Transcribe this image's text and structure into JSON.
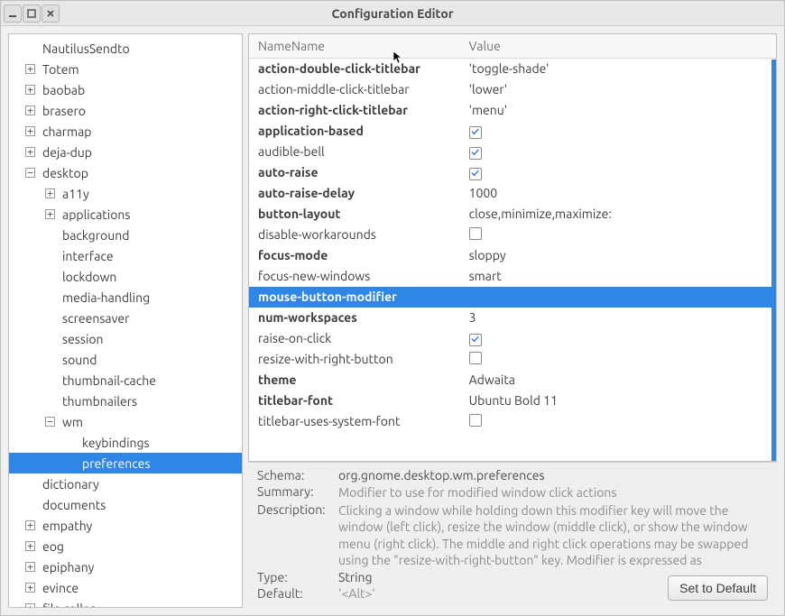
{
  "window_title": "Configuration Editor",
  "tree": [
    {
      "level": 1,
      "expand": "",
      "label": "NautilusSendto"
    },
    {
      "level": 1,
      "expand": "+",
      "label": "Totem"
    },
    {
      "level": 1,
      "expand": "+",
      "label": "baobab"
    },
    {
      "level": 1,
      "expand": "+",
      "label": "brasero"
    },
    {
      "level": 1,
      "expand": "+",
      "label": "charmap"
    },
    {
      "level": 1,
      "expand": "+",
      "label": "deja-dup"
    },
    {
      "level": 1,
      "expand": "-",
      "label": "desktop"
    },
    {
      "level": 2,
      "expand": "+",
      "label": "a11y"
    },
    {
      "level": 2,
      "expand": "+",
      "label": "applications"
    },
    {
      "level": 2,
      "expand": "",
      "label": "background"
    },
    {
      "level": 2,
      "expand": "",
      "label": "interface"
    },
    {
      "level": 2,
      "expand": "",
      "label": "lockdown"
    },
    {
      "level": 2,
      "expand": "",
      "label": "media-handling"
    },
    {
      "level": 2,
      "expand": "",
      "label": "screensaver"
    },
    {
      "level": 2,
      "expand": "",
      "label": "session"
    },
    {
      "level": 2,
      "expand": "",
      "label": "sound"
    },
    {
      "level": 2,
      "expand": "",
      "label": "thumbnail-cache"
    },
    {
      "level": 2,
      "expand": "",
      "label": "thumbnailers"
    },
    {
      "level": 2,
      "expand": "-",
      "label": "wm"
    },
    {
      "level": 3,
      "expand": "",
      "label": "keybindings"
    },
    {
      "level": 3,
      "expand": "",
      "label": "preferences",
      "selected": true
    },
    {
      "level": 1,
      "expand": "",
      "label": "dictionary"
    },
    {
      "level": 1,
      "expand": "",
      "label": "documents"
    },
    {
      "level": 1,
      "expand": "+",
      "label": "empathy"
    },
    {
      "level": 1,
      "expand": "+",
      "label": "eog"
    },
    {
      "level": 1,
      "expand": "+",
      "label": "epiphany"
    },
    {
      "level": 1,
      "expand": "+",
      "label": "evince"
    },
    {
      "level": 1,
      "expand": "+",
      "label": "file-roller"
    }
  ],
  "columns": {
    "name": "Name",
    "value": "Value"
  },
  "rows": [
    {
      "name": "action-double-click-titlebar",
      "bold": true,
      "valtype": "text",
      "value": "'toggle-shade'"
    },
    {
      "name": "action-middle-click-titlebar",
      "bold": false,
      "valtype": "text",
      "value": "'lower'"
    },
    {
      "name": "action-right-click-titlebar",
      "bold": true,
      "valtype": "text",
      "value": "'menu'"
    },
    {
      "name": "application-based",
      "bold": true,
      "valtype": "check",
      "value": true
    },
    {
      "name": "audible-bell",
      "bold": false,
      "valtype": "check",
      "value": true
    },
    {
      "name": "auto-raise",
      "bold": true,
      "valtype": "check",
      "value": true
    },
    {
      "name": "auto-raise-delay",
      "bold": true,
      "valtype": "text",
      "value": "1000"
    },
    {
      "name": "button-layout",
      "bold": true,
      "valtype": "text",
      "value": "close,minimize,maximize:"
    },
    {
      "name": "disable-workarounds",
      "bold": false,
      "valtype": "check",
      "value": false
    },
    {
      "name": "focus-mode",
      "bold": true,
      "valtype": "text",
      "value": "sloppy"
    },
    {
      "name": "focus-new-windows",
      "bold": false,
      "valtype": "text",
      "value": "smart"
    },
    {
      "name": "mouse-button-modifier",
      "bold": true,
      "valtype": "text",
      "value": "",
      "selected": true
    },
    {
      "name": "num-workspaces",
      "bold": true,
      "valtype": "text",
      "value": "3"
    },
    {
      "name": "raise-on-click",
      "bold": false,
      "valtype": "check",
      "value": true
    },
    {
      "name": "resize-with-right-button",
      "bold": false,
      "valtype": "check",
      "value": false
    },
    {
      "name": "theme",
      "bold": true,
      "valtype": "text",
      "value": "Adwaita"
    },
    {
      "name": "titlebar-font",
      "bold": true,
      "valtype": "text",
      "value": "Ubuntu Bold 11"
    },
    {
      "name": "titlebar-uses-system-font",
      "bold": false,
      "valtype": "check",
      "value": false
    }
  ],
  "details": {
    "schema_label": "Schema:",
    "schema": "org.gnome.desktop.wm.preferences",
    "summary_label": "Summary:",
    "summary": "Modifier to use for modified window click actions",
    "description_label": "Description:",
    "description": "Clicking a window while holding down this modifier key will move the window (left click), resize the window (middle click), or show the window menu (right click). The middle and right click operations may be swapped using the \"resize-with-right-button\" key. Modifier is expressed as",
    "type_label": "Type:",
    "type": "String",
    "default_label": "Default:",
    "default": "'<Alt>'",
    "button": "Set to Default"
  }
}
